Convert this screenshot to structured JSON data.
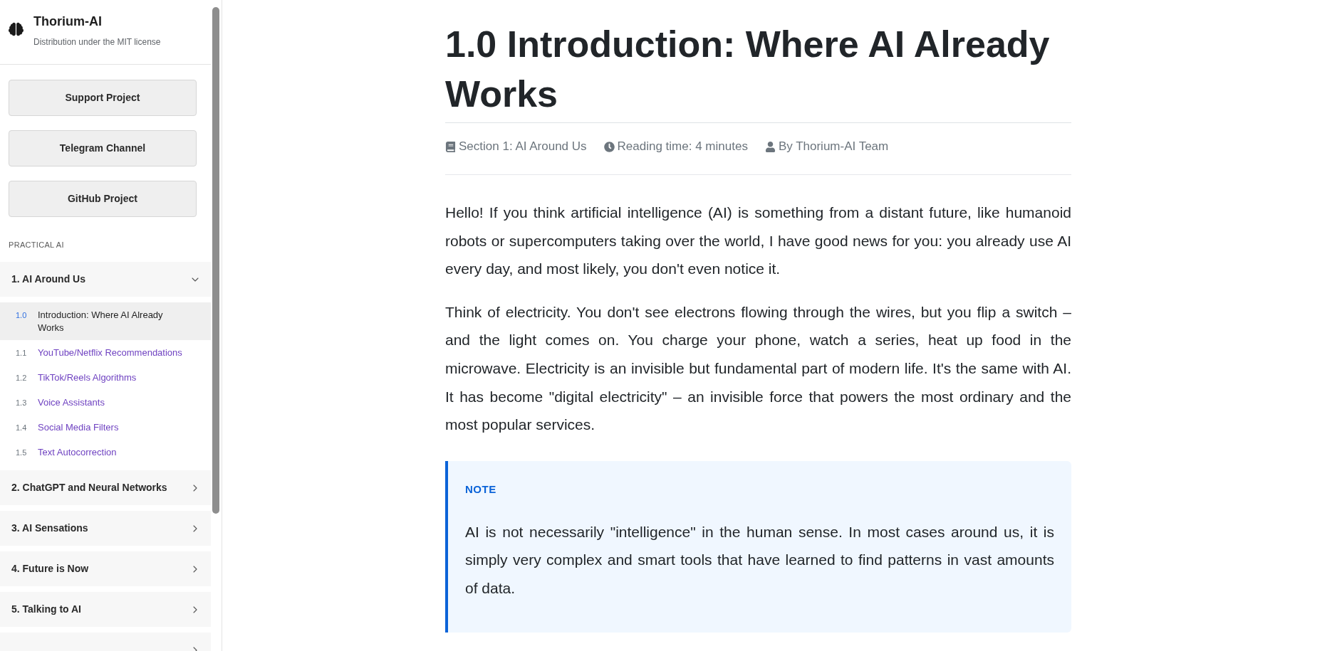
{
  "sidebar": {
    "brand": {
      "title": "Thorium-AI",
      "subtitle": "Distribution under the MIT license"
    },
    "buttons": [
      "Support Project",
      "Telegram Channel",
      "GitHub Project"
    ],
    "group_label": "PRACTICAL AI",
    "sections": [
      {
        "label": "1. AI Around Us",
        "expanded": true,
        "children": [
          {
            "number": "1.0",
            "label": "Introduction: Where AI Already Works",
            "selected": true
          },
          {
            "number": "1.1",
            "label": "YouTube/Netflix Recommendations",
            "selected": false
          },
          {
            "number": "1.2",
            "label": "TikTok/Reels Algorithms",
            "selected": false
          },
          {
            "number": "1.3",
            "label": "Voice Assistants",
            "selected": false
          },
          {
            "number": "1.4",
            "label": "Social Media Filters",
            "selected": false
          },
          {
            "number": "1.5",
            "label": "Text Autocorrection",
            "selected": false
          }
        ]
      },
      {
        "label": "2. ChatGPT and Neural Networks",
        "expanded": false
      },
      {
        "label": "3. AI Sensations",
        "expanded": false
      },
      {
        "label": "4. Future is Now",
        "expanded": false
      },
      {
        "label": "5. Talking to AI",
        "expanded": false
      },
      {
        "expanded": false
      }
    ]
  },
  "article": {
    "title": "1.0 Introduction: Where AI Already Works",
    "meta": [
      {
        "kind": "book",
        "text": "Section 1: AI Around Us"
      },
      {
        "kind": "clock",
        "text": "Reading time: 4 minutes"
      },
      {
        "kind": "user",
        "text": "By Thorium-AI Team"
      }
    ],
    "paragraphs": [
      "Hello! If you think artificial intelligence (AI) is something from a distant future, like humanoid robots or supercomputers taking over the world, I have good news for you: you already use AI every day, and most likely, you don't even notice it.",
      "Think of electricity. You don't see electrons flowing through the wires, but you flip a switch – and the light comes on. You charge your phone, watch a series, heat up food in the microwave. Electricity is an invisible but fundamental part of modern life. It's the same with AI. It has become \"digital electricity\" – an invisible force that powers the most ordinary and the most popular services."
    ],
    "note": {
      "label": "NOTE",
      "text": "AI is not necessarily \"intelligence\" in the human sense. In most cases around us, it is simply very complex and smart tools that have learned to find patterns in vast amounts of data."
    }
  }
}
